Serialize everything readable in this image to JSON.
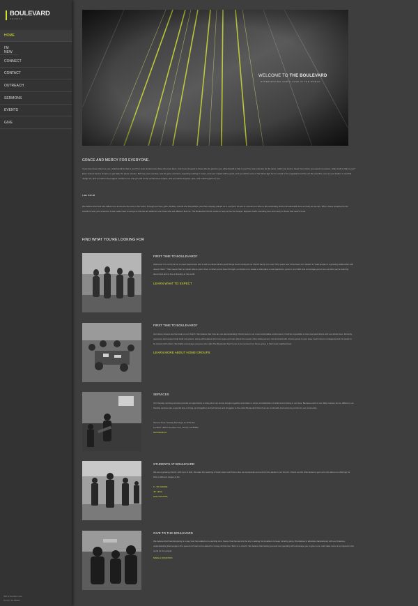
{
  "brand": {
    "name": "BOULEVARD",
    "sub": "CHURCH"
  },
  "colors": {
    "accent": "#d8e030",
    "sidebar": "#333333",
    "page": "#3e3e3e"
  },
  "nav": {
    "items": [
      {
        "label": "HOME"
      },
      {
        "label": "I'M NEW"
      },
      {
        "label": "CONNECT"
      },
      {
        "label": "CONTACT"
      },
      {
        "label": "OUTREACH"
      },
      {
        "label": "SERMONS"
      },
      {
        "label": "EVENTS"
      },
      {
        "label": "GIVE"
      }
    ]
  },
  "sidebar_footer": {
    "line1": "400 E Southern Ave",
    "line2": "Tempe, AZ 85282"
  },
  "hero": {
    "title_prefix": "WELCOME TO",
    "title_bold": "THE BOULEVARD",
    "subtitle": "EXPERIENCING GOD'S LOVE IN THE WORLD"
  },
  "intro": {
    "heading": "GRACE AND MERCY FOR EVERYONE.",
    "paragraph1": "If you love those who love you, what benefit is that to you? For even sinners love those who love them. And if you do good to those who do good to you, what benefit is that to you? For even sinners do the same. And if you lend to those from whom you expect to receive, what credit is that to you? Even sinners lend to sinners, to get back the same amount. But love your enemies, and do good, and lend, expecting nothing in return, and your reward will be great, and you will be sons of the Most High, for he is kind to the ungrateful and the evil. Be merciful, even as your Father is merciful. Judge not, and you will not be judged; condemn not, and you will not be condemned; forgive, and you will be forgiven; give, and it will be given to you.",
    "verse": "Luke 6:32-38",
    "paragraph2": "We believe that God has called us to announce the love in this world. Through our lives, jobs, families, friends and friendships, God has uniquely placed us in our lives, we are to connect our lives to demonstrating God's immeasurable love as freely as we can. When Jesus preached to the crowds to love your enemies, it was made clear to everyone that we are called to love those who are different than us. The Boulevard Church exists to help us live the Gospel. Express God's unending love and mercy to those that need it most."
  },
  "find": {
    "heading": "FIND WHAT YOU'RE LOOKING FOR"
  },
  "cards": [
    {
      "title": "FIRST TIME TO BOULEVARD?",
      "text": "Welcome! It is not by far so to meet newcomers and to tell you about all the good things God is doing at our church family. For over thirty years now it has been our mission to \"lead people in a growing relationship with Jesus Christ.\" That means that no matter where you're from or what you've been through, our desire is to create a safe place to ask questions, grow in your faith and encourage you to live out what you're learning about God and to live a blessing to the world.",
      "link": "LEARN WHAT TO EXPECT"
    },
    {
      "title": "FIRST TIME TO BOULEVARD?",
      "text": "Our Home Groups are the heart of our church. We believe that if we are not demonstrating Christ's love in our most comfortable environment, it will be impossible to love God and others with our whole lives. Sincerity, openness and respect help build our groups, along with leaders who love Jesus and care about the needs of the whole person. Get involved with a home group in your area, God's love is contagious and it's meant to be shared with others. We highly encourage everyone who calls The Boulevard their home to be involved in a home group in their local neighborhood.",
      "link": "LEARN MORE ABOUT HOME GROUPS"
    },
    {
      "title": "SERVICES",
      "text": "Our Sunday morning services provide an opportunity to bring all of our Home Groups together and share in a time of celebration of what God is doing in our lives. Because each of our daily routines are so different, our Sunday services are a special time to bring us all together and tell stories and struggles to the entire Boulevard Church as we continually God and pray to Him for our community.",
      "time": "Service Time: Sunday Mornings, at 10:00 am",
      "location": "Location: 400 E Southern Ave, Tempe, AZ 85282",
      "link": "Get Directions"
    },
    {
      "title": "STUDENTS AT BOULEVARD",
      "text": "We are a growing church, with tons of kids. We take the teaching of God's word and how to live as importantly as we do for the adults in our church. Check out the links below to get more info about our offerings for kids in different stages of life.",
      "links": [
        "K - 5th GRADE",
        "JR. HIGH",
        "HIGH SCHOOL"
      ]
    },
    {
      "title": "GIVE TO THE BOULEVARD",
      "text": "We believe that financial giving is a way God has called us to worship Him. Some churches tend to be shy in asking for donations to keep ministry going. We believe in absolute transparency with our finances, understanding that people in the pews don't want to be asked for money all the time. But it is a church. We believe that having you and our spending will encourage you to give more, and make more of an impact in this world for the gospel.",
      "link": "MAKE A DONATION"
    }
  ]
}
